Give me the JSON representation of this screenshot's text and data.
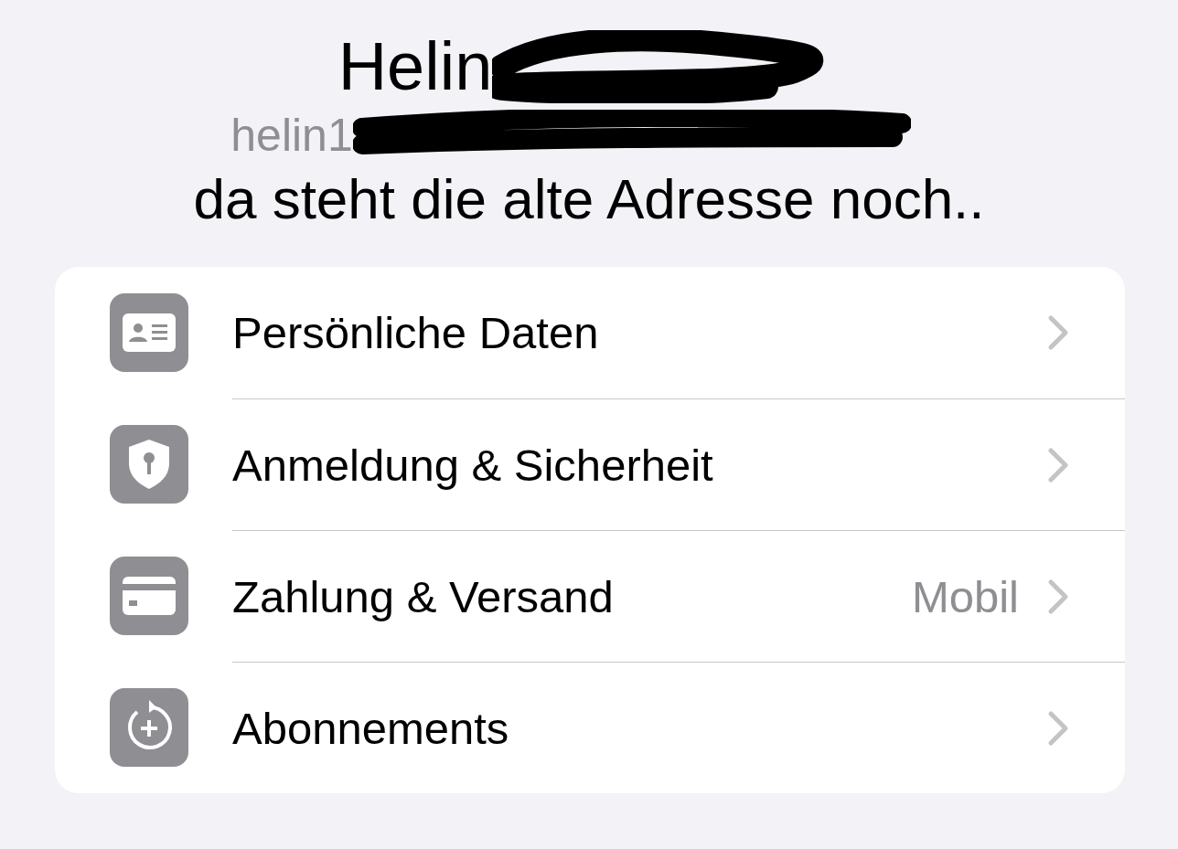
{
  "header": {
    "name": "Helin",
    "email": "helin1"
  },
  "caption": "da steht die alte Adresse noch..",
  "rows": [
    {
      "kind": "id-card",
      "label": "Persönliche Daten"
    },
    {
      "kind": "shield",
      "label": "Anmeldung & Sicherheit"
    },
    {
      "kind": "card",
      "label": "Zahlung & Versand",
      "value": "Mobil"
    },
    {
      "kind": "subscription",
      "label": "Abonnements"
    }
  ]
}
